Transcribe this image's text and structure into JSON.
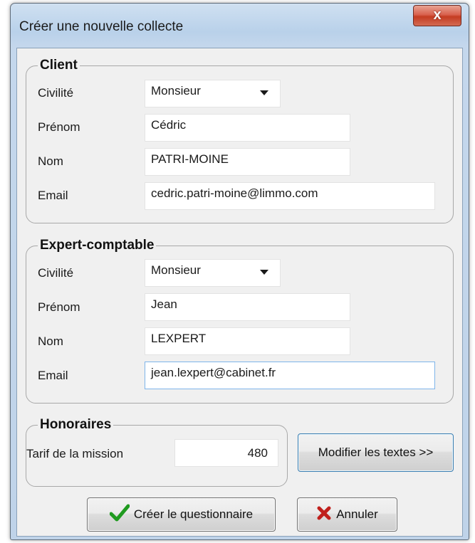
{
  "window": {
    "title": "Créer une nouvelle collecte",
    "close_label": "x"
  },
  "client": {
    "title": "Client",
    "civilite_label": "Civilité",
    "civilite_value": "Monsieur",
    "prenom_label": "Prénom",
    "prenom_value": "Cédric",
    "nom_label": "Nom",
    "nom_value": "PATRI-MOINE",
    "email_label": "Email",
    "email_value": "cedric.patri-moine@limmo.com"
  },
  "expert": {
    "title": "Expert-comptable",
    "civilite_label": "Civilité",
    "civilite_value": "Monsieur",
    "prenom_label": "Prénom",
    "prenom_value": "Jean",
    "nom_label": "Nom",
    "nom_value": "LEXPERT",
    "email_label": "Email",
    "email_value": "jean.lexpert@cabinet.fr"
  },
  "honoraires": {
    "title": "Honoraires",
    "tarif_label": "Tarif de la mission",
    "tarif_value": "480"
  },
  "buttons": {
    "modifier_label": "Modifier les textes >>",
    "create_label": "Créer le questionnaire",
    "cancel_label": "Annuler"
  },
  "icons": {
    "check": "check-icon",
    "cross": "cross-icon",
    "dropdown": "chevron-down-icon"
  },
  "colors": {
    "title_bar": "#b9d1ea",
    "close_button": "#c43c22",
    "check_green": "#1f9a1f",
    "cross_red": "#c0201c",
    "focus_border": "#7eb4ea"
  }
}
